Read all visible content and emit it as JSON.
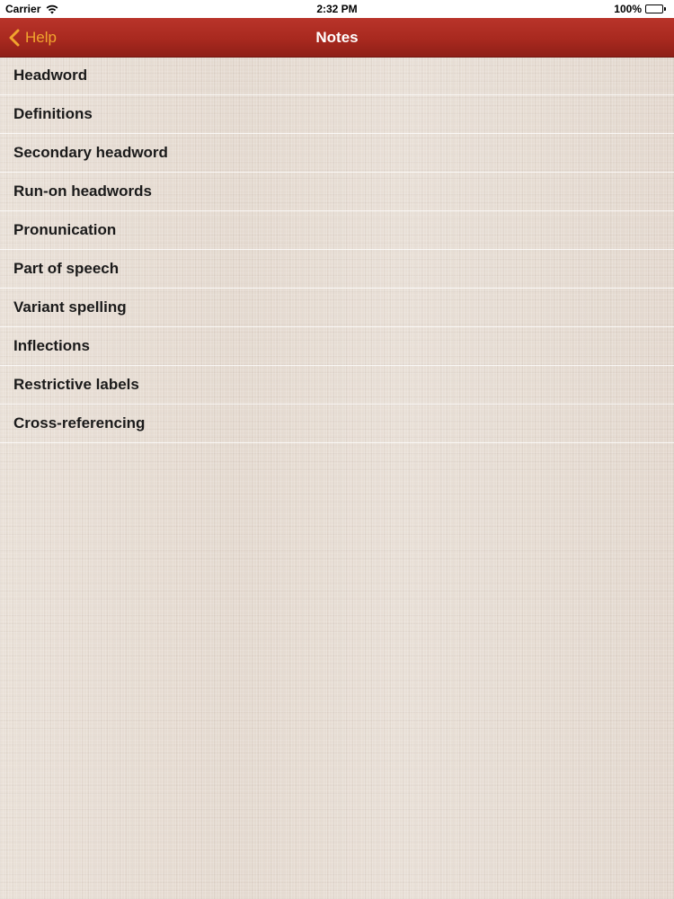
{
  "status_bar": {
    "carrier": "Carrier",
    "time": "2:32 PM",
    "battery": "100%",
    "battery_level": 1.0
  },
  "nav": {
    "back_label": "Help",
    "title": "Notes",
    "back_color": "#f1a52e",
    "bar_color": "#a8291f"
  },
  "list": {
    "items": [
      {
        "label": "Headword"
      },
      {
        "label": "Definitions"
      },
      {
        "label": "Secondary headword"
      },
      {
        "label": "Run-on headwords"
      },
      {
        "label": "Pronunication"
      },
      {
        "label": "Part of speech"
      },
      {
        "label": "Variant spelling"
      },
      {
        "label": "Inflections"
      },
      {
        "label": "Restrictive labels"
      },
      {
        "label": "Cross-referencing"
      }
    ]
  }
}
